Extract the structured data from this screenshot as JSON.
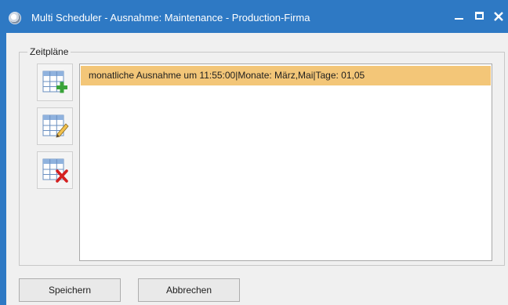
{
  "window": {
    "title": "Multi Scheduler - Ausnahme: Maintenance - Production-Firma",
    "icon": "app-icon"
  },
  "group": {
    "label": "Zeitpläne"
  },
  "toolbar": {
    "items": [
      {
        "name": "add-schedule",
        "icon": "grid-add-icon"
      },
      {
        "name": "edit-schedule",
        "icon": "grid-edit-icon"
      },
      {
        "name": "delete-schedule",
        "icon": "grid-delete-icon"
      }
    ]
  },
  "list": {
    "items": [
      {
        "text": "monatliche Ausnahme um 11:55:00|Monate: März,Mai|Tage: 01,05",
        "selected": true
      }
    ]
  },
  "buttons": {
    "save_label": "Speichern",
    "cancel_label": "Abbrechen"
  },
  "colors": {
    "titlebar": "#2e79c4",
    "selection": "#f3c678",
    "add_accent": "#3aa33a",
    "delete_accent": "#d42020"
  }
}
